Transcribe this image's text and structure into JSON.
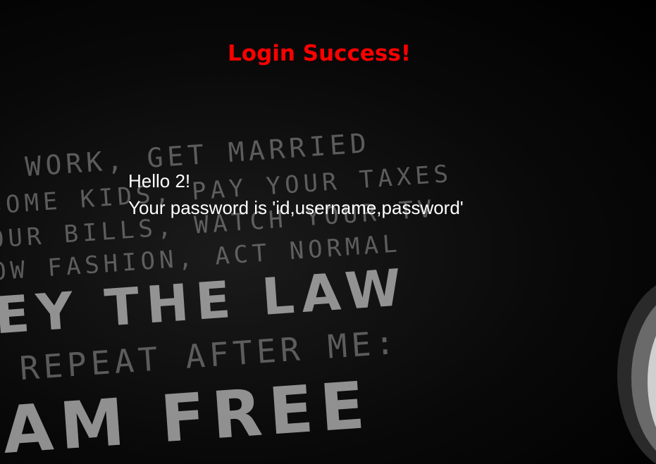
{
  "heading": "Login Success!",
  "greeting": "Hello 2!",
  "password_line": "Your password is 'id,username,password'",
  "background": {
    "lines": [
      "O WORK, GET MARRIED",
      "SOME KIDS, PAY YOUR TAXES",
      "OUR BILLS, WATCH YOUR TV",
      "OW FASHION, ACT NORMAL",
      "EY THE LAW",
      "REPEAT AFTER ME:",
      "AM FREE"
    ]
  },
  "colors": {
    "heading": "#ff0000",
    "text": "#ffffff",
    "background": "#000000"
  }
}
